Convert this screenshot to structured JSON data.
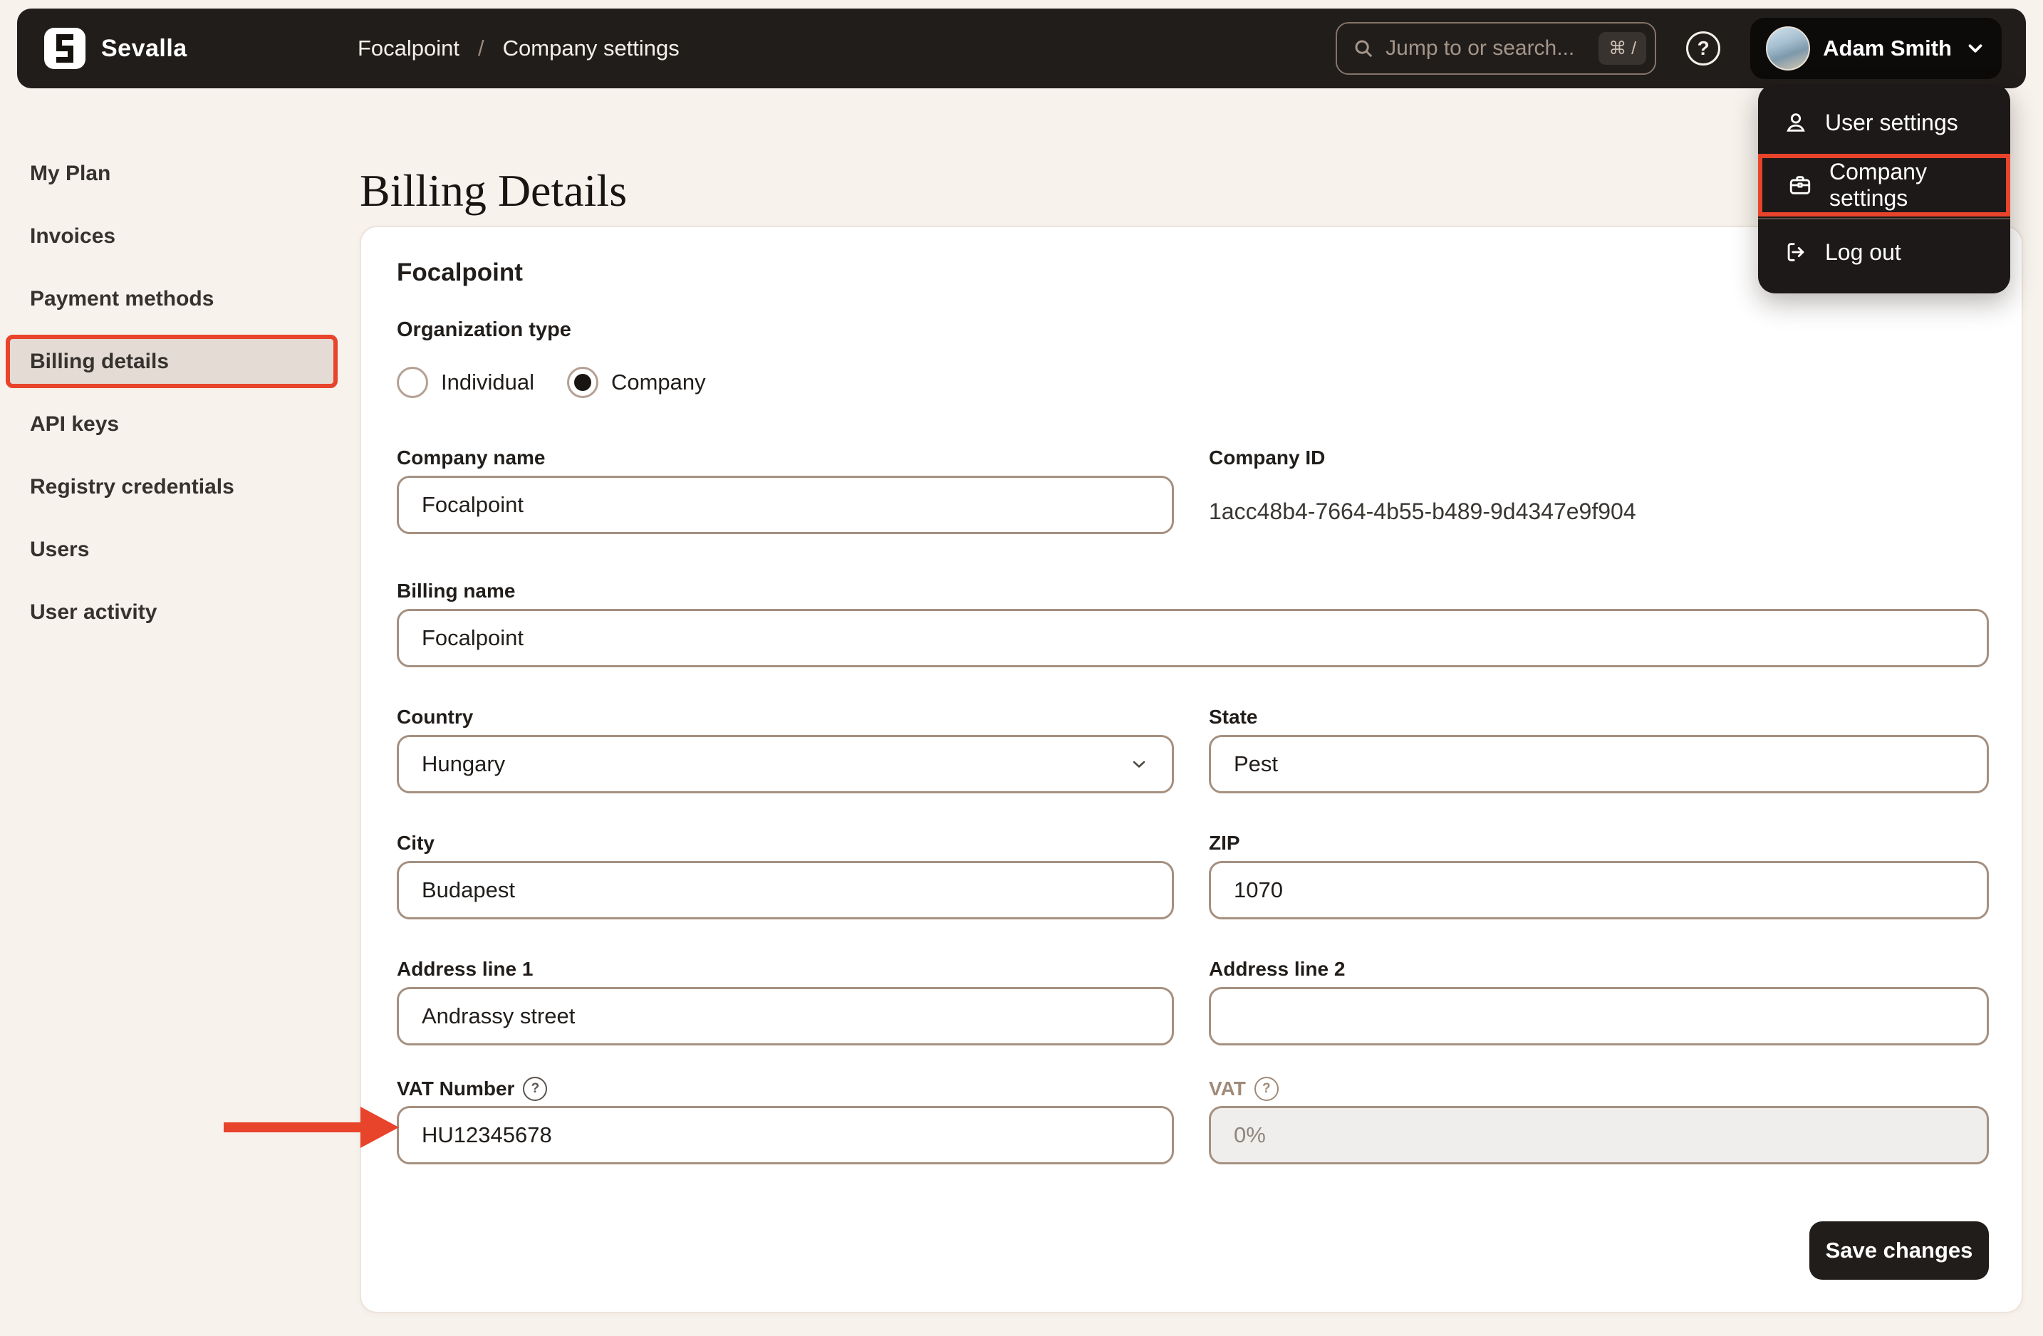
{
  "topbar": {
    "brand": "Sevalla",
    "breadcrumb": {
      "project": "Focalpoint",
      "separator": "/",
      "page": "Company settings"
    },
    "search": {
      "placeholder": "Jump to or search...",
      "shortcut": "⌘ /"
    },
    "help_label": "?",
    "user": {
      "name": "Adam Smith"
    }
  },
  "user_menu": {
    "items": [
      {
        "label": "User settings",
        "icon": "user-icon"
      },
      {
        "label": "Company settings",
        "icon": "briefcase-icon"
      },
      {
        "label": "Log out",
        "icon": "logout-icon"
      }
    ]
  },
  "sidebar": {
    "items": [
      {
        "label": "My Plan"
      },
      {
        "label": "Invoices"
      },
      {
        "label": "Payment methods"
      },
      {
        "label": "Billing details"
      },
      {
        "label": "API keys"
      },
      {
        "label": "Registry credentials"
      },
      {
        "label": "Users"
      },
      {
        "label": "User activity"
      }
    ],
    "active_item": "Billing details"
  },
  "page": {
    "title": "Billing Details"
  },
  "card": {
    "title": "Focalpoint",
    "organization_type": {
      "label": "Organization type",
      "options": [
        {
          "label": "Individual",
          "selected": false
        },
        {
          "label": "Company",
          "selected": true
        }
      ]
    },
    "fields": {
      "company_name": {
        "label": "Company name",
        "value": "Focalpoint"
      },
      "company_id": {
        "label": "Company ID",
        "value": "1acc48b4-7664-4b55-b489-9d4347e9f904"
      },
      "billing_name": {
        "label": "Billing name",
        "value": "Focalpoint"
      },
      "country": {
        "label": "Country",
        "value": "Hungary"
      },
      "state": {
        "label": "State",
        "value": "Pest"
      },
      "city": {
        "label": "City",
        "value": "Budapest"
      },
      "zip": {
        "label": "ZIP",
        "value": "1070"
      },
      "address1": {
        "label": "Address line 1",
        "value": "Andrassy street"
      },
      "address2": {
        "label": "Address line 2",
        "value": ""
      },
      "vat_number": {
        "label": "VAT Number",
        "value": "HU12345678"
      },
      "vat": {
        "label": "VAT",
        "value": "0%"
      }
    },
    "save_label": "Save changes"
  },
  "colors": {
    "accent_red": "#e8432b",
    "topbar_bg": "#211d1a",
    "page_bg": "#f7f2ec",
    "card_bg": "#ffffff",
    "active_item_bg": "#e4dbd4",
    "input_border": "#a59080"
  }
}
